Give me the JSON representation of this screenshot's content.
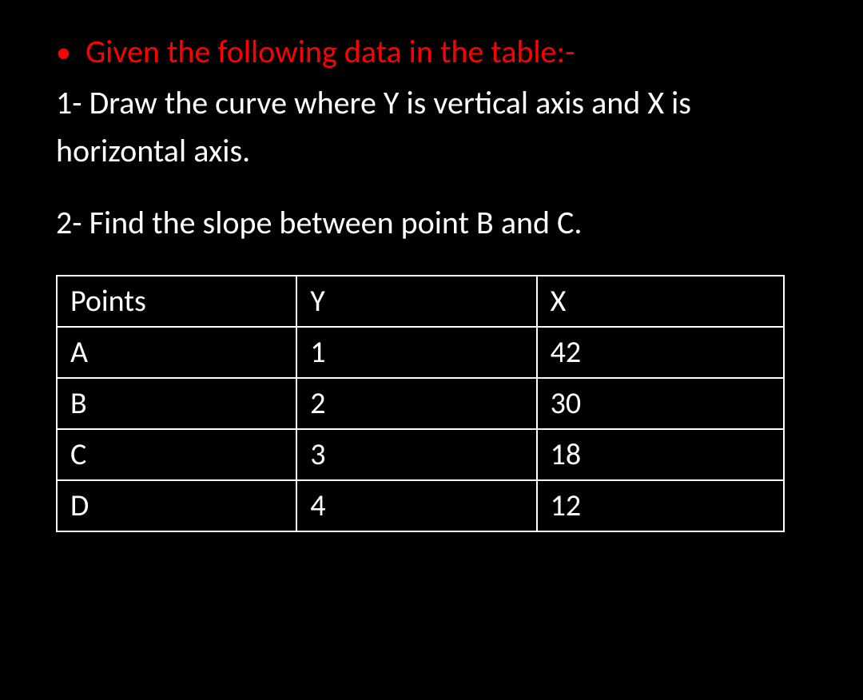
{
  "heading": "Given the following data in the table:-",
  "instruction1": "1- Draw the curve where Y is vertical axis and X is horizontal axis.",
  "instruction2": "2- Find the slope between point B and C.",
  "table": {
    "headers": {
      "col0": "Points",
      "col1": "Y",
      "col2": "X"
    },
    "rows": [
      {
        "point": "A",
        "y": "1",
        "x": "42"
      },
      {
        "point": "B",
        "y": "2",
        "x": "30"
      },
      {
        "point": "C",
        "y": "3",
        "x": "18"
      },
      {
        "point": "D",
        "y": "4",
        "x": "12"
      }
    ]
  },
  "chart_data": {
    "type": "table",
    "columns": [
      "Points",
      "Y",
      "X"
    ],
    "data": [
      {
        "Points": "A",
        "Y": 1,
        "X": 42
      },
      {
        "Points": "B",
        "Y": 2,
        "X": 30
      },
      {
        "Points": "C",
        "Y": 3,
        "X": 18
      },
      {
        "Points": "D",
        "Y": 4,
        "X": 12
      }
    ]
  }
}
